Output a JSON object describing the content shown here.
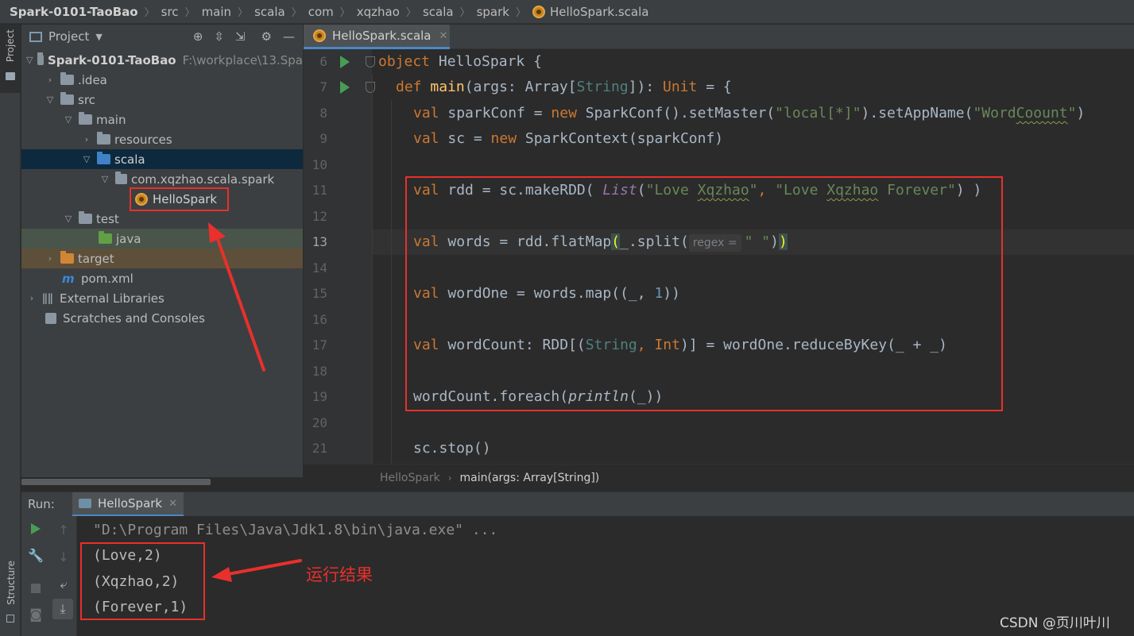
{
  "breadcrumb": [
    "Spark-0101-TaoBao",
    "src",
    "main",
    "scala",
    "com",
    "xqzhao",
    "scala",
    "spark",
    "HelloSpark.scala"
  ],
  "sidebar": {
    "project_tab": "Project",
    "structure_tab": "Structure"
  },
  "project_panel": {
    "title": "Project",
    "tree": [
      {
        "label": "Spark-0101-TaoBao",
        "path": "F:\\workplace\\13.Spa"
      },
      {
        "label": ".idea"
      },
      {
        "label": "src"
      },
      {
        "label": "main"
      },
      {
        "label": "resources"
      },
      {
        "label": "scala"
      },
      {
        "label": "com.xqzhao.scala.spark"
      },
      {
        "label": "HelloSpark"
      },
      {
        "label": "test"
      },
      {
        "label": "java"
      },
      {
        "label": "target"
      },
      {
        "label": "pom.xml"
      },
      {
        "label": "External Libraries"
      },
      {
        "label": "Scratches and Consoles"
      }
    ]
  },
  "editor": {
    "tab_title": "HelloSpark.scala",
    "line_numbers": [
      "6",
      "7",
      "8",
      "9",
      "10",
      "11",
      "12",
      "13",
      "14",
      "15",
      "16",
      "17",
      "18",
      "19",
      "20",
      "21"
    ],
    "current_line": "13",
    "param_hint": "regex =",
    "breadcrumb": [
      "HelloSpark",
      "main(args: Array[String])"
    ],
    "code": {
      "l6_kw": "object",
      "l6_rest": " HelloSpark {",
      "l7_kw": "def",
      "l7_fn": "main",
      "l7_a": "(args: Array[",
      "l7_ty": "String",
      "l7_b": "]): ",
      "l7_unit": "Unit",
      "l7_c": " = {",
      "l8_val": "val",
      "l8_a": " sparkConf = ",
      "l8_new": "new",
      "l8_b": " SparkConf().setMaster(",
      "l8_s1": "\"local[*]\"",
      "l8_c": ").setAppName(",
      "l8_s2a": "\"Word",
      "l8_s2b": "Coount",
      "l8_s2c": "\"",
      "l8_d": ")",
      "l9_val": "val",
      "l9_a": " sc = ",
      "l9_new": "new",
      "l9_b": " SparkContext(sparkConf)",
      "l11_val": "val",
      "l11_a": " rdd = sc.makeRDD( ",
      "l11_list": "List",
      "l11_b": "(",
      "l11_s1a": "\"Love ",
      "l11_s1b": "Xqzhao",
      "l11_s1c": "\"",
      "l11_c": ", ",
      "l11_s2a": "\"Love ",
      "l11_s2b": "Xqzhao",
      "l11_s2c": " Forever\"",
      "l11_d": ") )",
      "l13_val": "val",
      "l13_a": " words = rdd.flatMap",
      "l13_p1": "(",
      "l13_b": "_.split(",
      "l13_s": "\" \"",
      "l13_c": ")",
      "l13_p2": ")",
      "l15_val": "val",
      "l15_a": " wordOne = words.map((_, ",
      "l15_num": "1",
      "l15_b": "))",
      "l17_val": "val",
      "l17_a": " wordCount: RDD[(",
      "l17_ty": "String",
      "l17_b": ", ",
      "l17_int": "Int",
      "l17_c": ")] = wordOne.reduceByKey(_ + _)",
      "l19_a": "wordCount.foreach(",
      "l19_fn": "println",
      "l19_b": "(_))",
      "l21_a": "sc.stop()"
    }
  },
  "run_panel": {
    "label": "Run:",
    "tab_title": "HelloSpark",
    "console": [
      "\"D:\\Program Files\\Java\\Jdk1.8\\bin\\java.exe\" ...",
      "(Love,2)",
      "(Xqzhao,2)",
      "(Forever,1)"
    ]
  },
  "annotation": {
    "text": "运行结果",
    "color": "#e8302c"
  },
  "watermark": "CSDN @页川叶川",
  "colors": {
    "keyword": "#cc7832",
    "string": "#6a8759",
    "function": "#ffc66d",
    "number": "#6897bb",
    "selection": "#0d293e",
    "run_green": "#499c54"
  },
  "icons": {
    "run_gutter": "green-triangle-run-icon",
    "file": "scala-object-icon",
    "maven": "maven-m-icon"
  }
}
